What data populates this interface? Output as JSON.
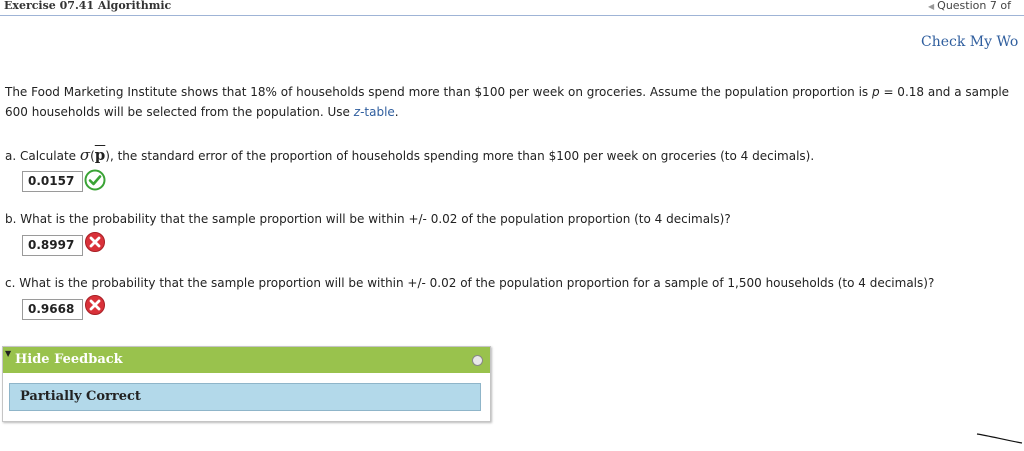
{
  "header": {
    "exercise_title": "Exercise 07.41 Algorithmic",
    "question_nav": "Question 7 of"
  },
  "check_my_work": "Check My Wo",
  "problem": {
    "line1_pre": "The Food Marketing Institute shows that 18% of households spend more than $100 per week on groceries. Assume the population proportion is ",
    "line1_var": "p",
    "line1_post": " = 0.18 and a sample",
    "line2_pre": "600 households will be selected from the population. Use ",
    "table_link_z": "z",
    "table_link_rest": "-table",
    "line2_post": "."
  },
  "questions": [
    {
      "pre": "a. Calculate ",
      "sigma": "σ",
      "open": "(",
      "pbar": "p",
      "close": ")",
      "post": ", the standard error of the proportion of households spending more than $100 per week on groceries (to 4 decimals).",
      "answer": "0.0157",
      "status": "correct"
    },
    {
      "text": "b. What is the probability that the sample proportion will be within +/- 0.02 of the population proportion (to 4 decimals)?",
      "answer": "0.8997",
      "status": "incorrect"
    },
    {
      "text": "c. What is the probability that the sample proportion will be within +/- 0.02 of the population proportion for a sample of 1,500 households (to 4 decimals)?",
      "answer": "0.9668",
      "status": "incorrect"
    }
  ],
  "feedback": {
    "toggle_label": "Hide Feedback",
    "result": "Partially Correct"
  },
  "colors": {
    "link": "#2f5e9e",
    "feedback_header": "#99c24d",
    "feedback_result": "#b3d9ea",
    "correct": "#3aa335",
    "incorrect": "#d9323a"
  },
  "icons": {
    "correct": "check-circle-icon",
    "incorrect": "x-circle-icon",
    "nav": "triangle-left-icon",
    "toggle": "triangle-down-icon"
  }
}
